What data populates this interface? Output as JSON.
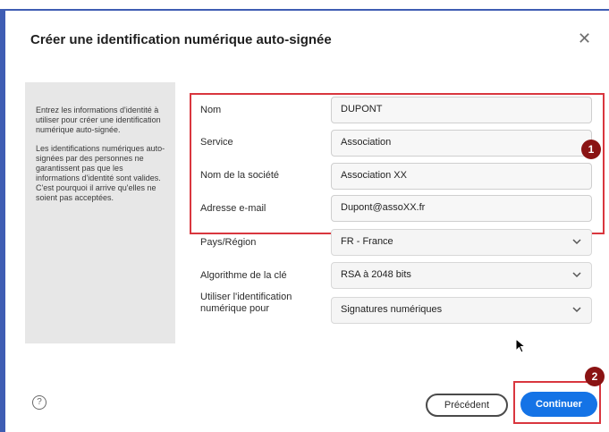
{
  "dialog": {
    "title": "Créer une identification numérique auto-signée",
    "close_icon": "close-icon"
  },
  "info_panel": {
    "paragraph1": "Entrez les informations d'identité à utiliser pour créer une identification numérique auto-signée.",
    "paragraph2": "Les identifications numériques auto-signées par des personnes ne garantissent pas que les informations d'identité sont valides. C'est pourquoi il arrive qu'elles ne soient pas acceptées."
  },
  "form": {
    "name_label": "Nom",
    "name_value": "DUPONT",
    "service_label": "Service",
    "service_value": "Association",
    "company_label": "Nom de la société",
    "company_value": "Association XX",
    "email_label": "Adresse e-mail",
    "email_value": "Dupont@assoXX.fr",
    "country_label": "Pays/Région",
    "country_value": "FR - France",
    "algorithm_label": "Algorithme de la clé",
    "algorithm_value": "RSA à 2048 bits",
    "usage_label": "Utiliser l'identification numérique pour",
    "usage_value": "Signatures numériques"
  },
  "annotations": {
    "badge1": "1",
    "badge2": "2",
    "highlight_color": "#d9363e",
    "badge_color": "#8a1313"
  },
  "footer": {
    "help_icon": "help-icon",
    "help_glyph": "?",
    "previous_label": "Précédent",
    "continue_label": "Continuer"
  },
  "colors": {
    "accent": "#1473e6",
    "frame": "#3f5db3"
  }
}
